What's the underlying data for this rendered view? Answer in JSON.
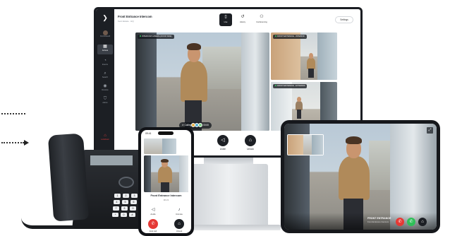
{
  "monitor": {
    "title": "Front Entrance Intercom",
    "subtitle": "Kent Estate · HQ",
    "settings_label": "Settings",
    "sidebar": {
      "items": [
        {
          "label": "Pel Rosswill",
          "icon": "user-avatar-icon"
        },
        {
          "label": "Access",
          "icon": "grid-icon"
        },
        {
          "label": "Events",
          "icon": "bell-icon"
        },
        {
          "label": "Search",
          "icon": "search-icon"
        },
        {
          "label": "Devices",
          "icon": "camera-icon"
        },
        {
          "label": "Admin",
          "icon": "shield-icon"
        },
        {
          "label": "Lockdown",
          "icon": "lock-icon"
        }
      ]
    },
    "tabs": [
      {
        "label": "Live",
        "icon": "intercom-icon"
      },
      {
        "label": "History",
        "icon": "history-icon"
      },
      {
        "label": "Conferencing",
        "icon": "people-icon"
      }
    ],
    "cameras": [
      {
        "tag": "INTERCOM CAMERA (DOOR SIDE)"
      },
      {
        "tag": "FRONT ENTRANCE - INTERIOR"
      },
      {
        "tag": "FRONT ENTRANCE - EXTERIOR"
      }
    ],
    "calling_label": "Calling",
    "call_timer": "00:00",
    "actions": [
      {
        "label": "Listen",
        "icon": "speaker-icon"
      },
      {
        "label": "Unlock",
        "icon": "lock-icon"
      }
    ]
  },
  "smartphone": {
    "status_time": "09:41",
    "title": "Front Entrance Intercom",
    "call_time": "00:21",
    "controls": [
      {
        "label": "Audio",
        "icon": "speaker-icon"
      },
      {
        "label": "Unmute",
        "icon": "microphone-icon"
      }
    ],
    "actions": [
      {
        "label": "End call",
        "icon": "hang-up-icon"
      },
      {
        "label": "Unlock",
        "icon": "lock-icon"
      }
    ]
  },
  "tablet": {
    "title": "FRONT ENTRANCE",
    "subtitle": "Front Entrance Intercom"
  },
  "deskphone": {
    "keys": [
      "1",
      "2",
      "3",
      "4",
      "5",
      "6",
      "7",
      "8",
      "9",
      "*",
      "0",
      "#"
    ]
  },
  "colors": {
    "dark": "#1c1f24",
    "end_call": "#e53935",
    "answer": "#2fbf58",
    "accent": "#ffffff"
  }
}
